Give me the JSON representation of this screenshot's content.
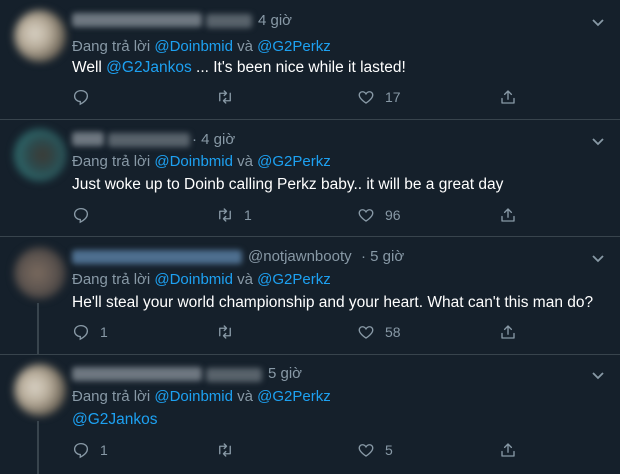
{
  "tweets": [
    {
      "handle": "",
      "time": "4 giờ",
      "replying_prefix": "Đang trả lời",
      "mention1": "@Doinbmid",
      "joiner": "và",
      "mention2": "@G2Perkz",
      "body_pre": "Well ",
      "body_mention": "@G2Jankos",
      "body_post": " ... It's been nice while it lasted!",
      "reply_count": "",
      "retweet_count": "",
      "like_count": "17"
    },
    {
      "handle": "",
      "time": "· 4 giờ",
      "replying_prefix": "Đang trả lời",
      "mention1": "@Doinbmid",
      "joiner": "và",
      "mention2": "@G2Perkz",
      "body_pre": "Just woke up to Doinb calling Perkz baby.. it will be a great day",
      "body_mention": "",
      "body_post": "",
      "reply_count": "",
      "retweet_count": "1",
      "like_count": "96"
    },
    {
      "handle": "@notjawnbooty",
      "time": "· 5 giờ",
      "replying_prefix": "Đang trả lời",
      "mention1": "@Doinbmid",
      "joiner": "và",
      "mention2": "@G2Perkz",
      "body_pre": "He'll steal your world championship and your heart. What can't this man do?",
      "body_mention": "",
      "body_post": "",
      "reply_count": "1",
      "retweet_count": "",
      "like_count": "58"
    },
    {
      "handle": "",
      "time": "5 giờ",
      "replying_prefix": "Đang trả lời",
      "mention1": "@Doinbmid",
      "joiner": "và",
      "mention2": "@G2Perkz",
      "body_pre": "",
      "body_mention": "@G2Jankos",
      "body_post": "",
      "reply_count": "1",
      "retweet_count": "",
      "like_count": "5"
    }
  ],
  "icons": {
    "reply": "reply-icon",
    "retweet": "retweet-icon",
    "like": "heart-icon",
    "share": "share-icon",
    "more": "chevron-down-icon"
  },
  "colors": {
    "background": "#15202b",
    "text": "#ffffff",
    "muted": "#8899a6",
    "accent": "#1da1f2",
    "border": "#38444d"
  }
}
